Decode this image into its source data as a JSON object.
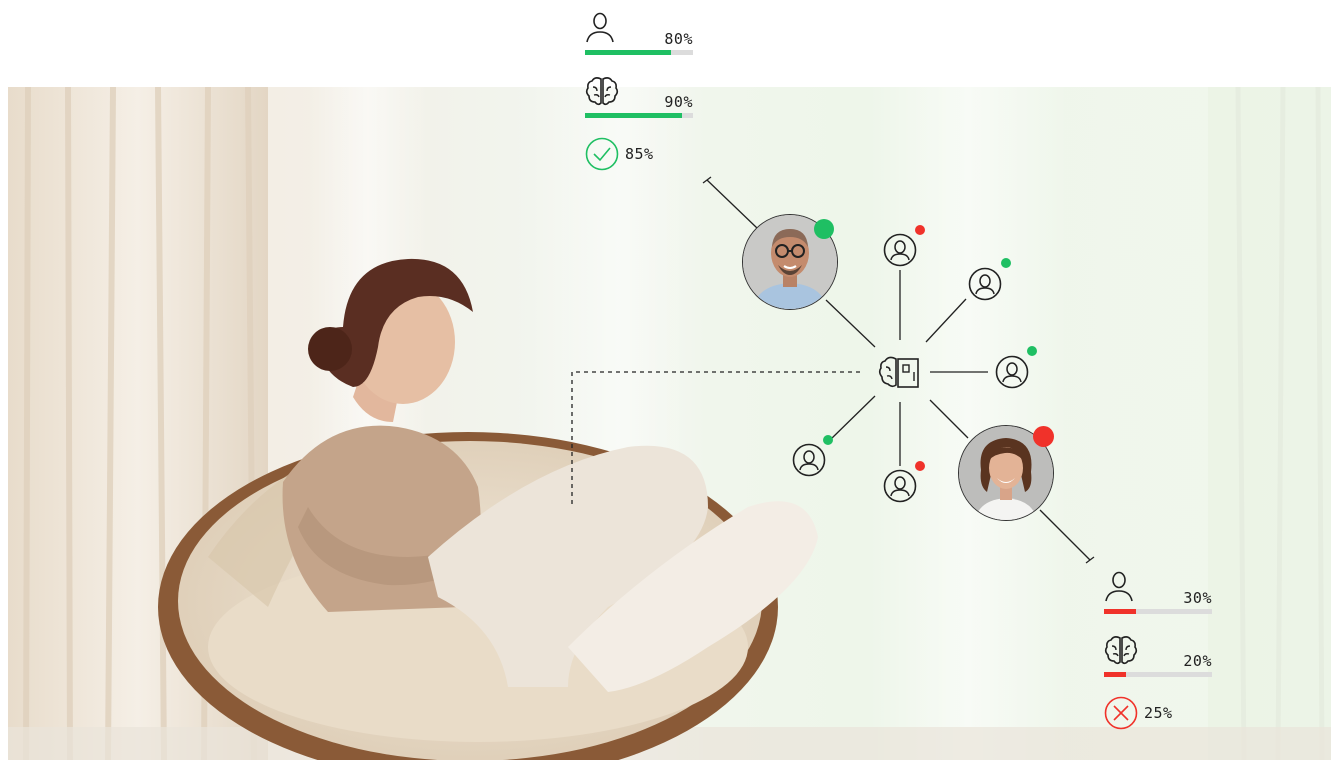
{
  "colors": {
    "good": "#1fbf63",
    "bad": "#f0322a",
    "track": "#dcdcdc",
    "line": "#222222"
  },
  "top_profile": {
    "avatar_status": "good",
    "personality": {
      "icon": "person-icon",
      "label": "80%",
      "value": 0.8
    },
    "intelligence": {
      "icon": "brain-icon",
      "label": "90%",
      "value": 0.9
    },
    "overall": {
      "icon": "check-circle-icon",
      "label": "85%",
      "status": "good"
    }
  },
  "bottom_profile": {
    "avatar_status": "bad",
    "personality": {
      "icon": "person-icon",
      "label": "30%",
      "value": 0.3
    },
    "intelligence": {
      "icon": "brain-icon",
      "label": "20%",
      "value": 0.2
    },
    "overall": {
      "icon": "x-circle-icon",
      "label": "25%",
      "status": "bad"
    }
  },
  "hub": {
    "icon": "ai-brain-icon"
  },
  "candidate_nodes": [
    {
      "icon": "user-circle-icon",
      "status": "bad"
    },
    {
      "icon": "user-circle-icon",
      "status": "good"
    },
    {
      "icon": "user-circle-icon",
      "status": "good"
    },
    {
      "icon": "user-circle-icon",
      "status": "bad"
    },
    {
      "icon": "user-circle-icon",
      "status": "good"
    }
  ]
}
